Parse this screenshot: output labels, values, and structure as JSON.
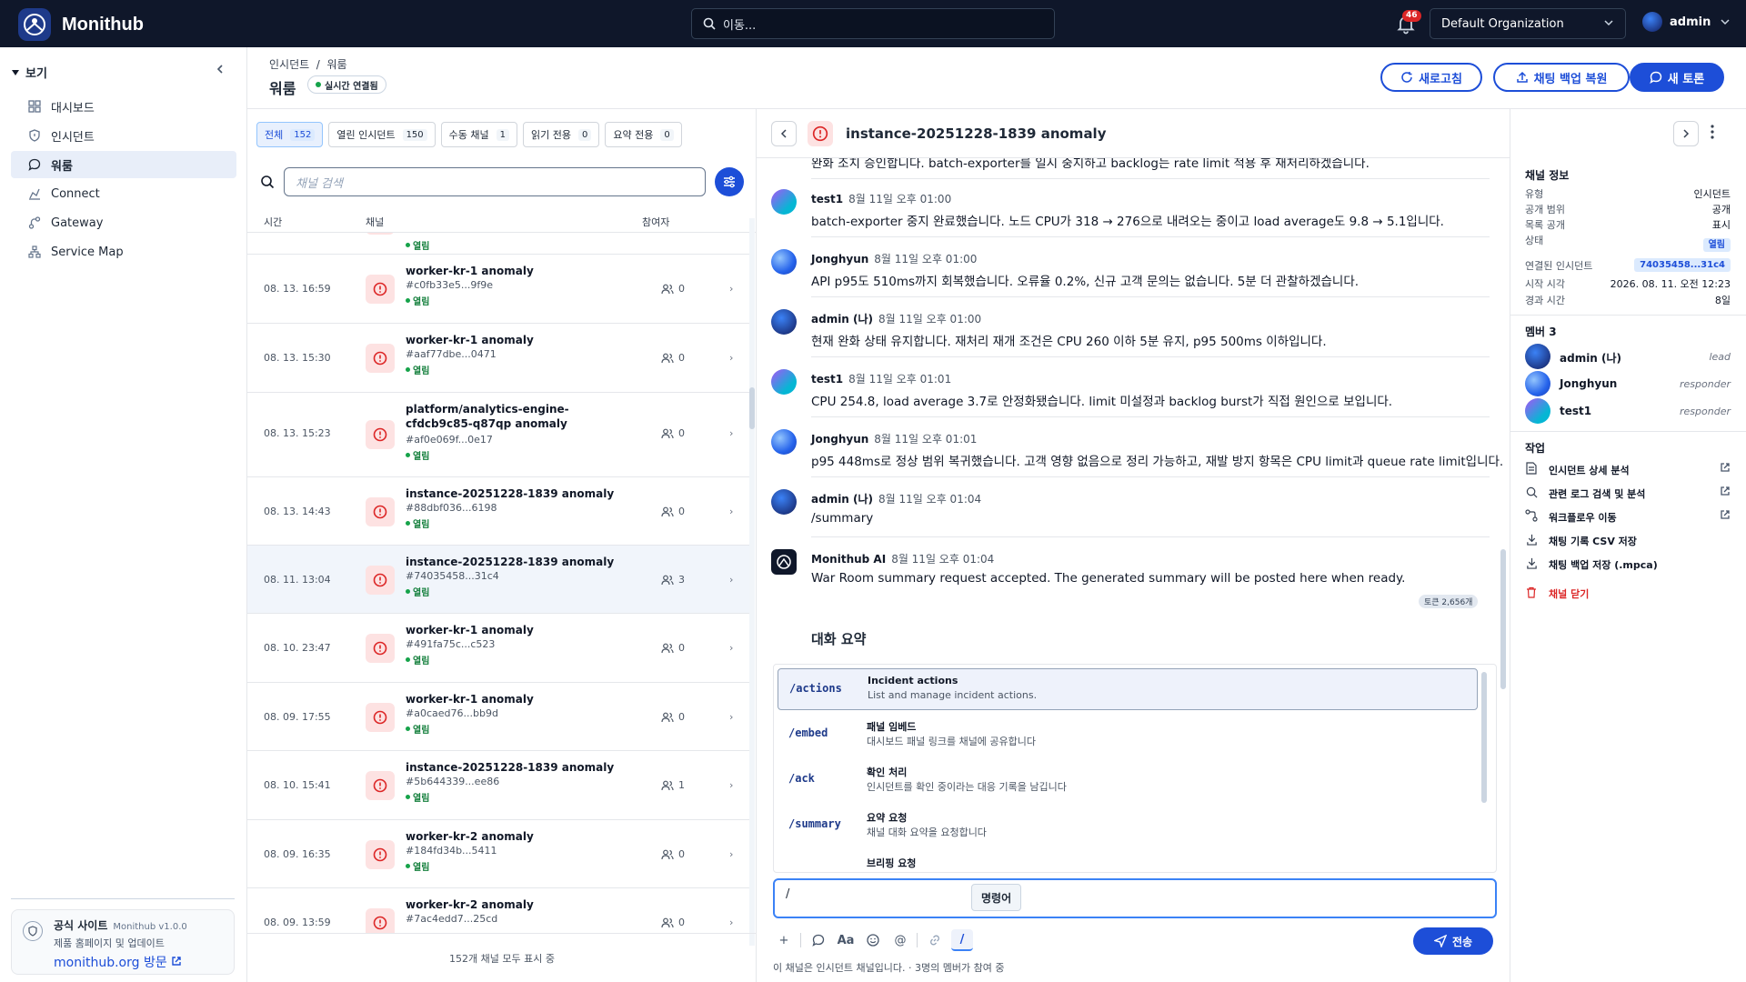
{
  "app": {
    "name": "Monithub",
    "search_placeholder": "이동...",
    "notif_count": "46",
    "org": "Default Organization",
    "user": "admin"
  },
  "sidebar": {
    "header": "보기",
    "items": [
      {
        "label": "대시보드",
        "icon": "dashboard-icon"
      },
      {
        "label": "인시던트",
        "icon": "shield-icon"
      },
      {
        "label": "워룸",
        "icon": "chat-icon"
      },
      {
        "label": "Connect",
        "icon": "connect-icon"
      },
      {
        "label": "Gateway",
        "icon": "gateway-icon"
      },
      {
        "label": "Service Map",
        "icon": "service-map-icon"
      }
    ],
    "promo": {
      "title": "공식 사이트",
      "version": "Monithub v1.0.0",
      "subtitle": "제품 홈페이지 및 업데이트",
      "link": "monithub.org 방문"
    }
  },
  "header": {
    "breadcrumb": "인시던트  /  워룸",
    "title": "워룸",
    "live": "실시간 연결됨",
    "buttons": {
      "refresh": "새로고침",
      "restore": "채팅 백업 복원",
      "new": "새 토론"
    }
  },
  "list": {
    "tabs": [
      {
        "label": "전체",
        "count": "152"
      },
      {
        "label": "열린 인시던트",
        "count": "150"
      },
      {
        "label": "수동 채널",
        "count": "1"
      },
      {
        "label": "읽기 전용",
        "count": "0"
      },
      {
        "label": "요약 전용",
        "count": "0"
      }
    ],
    "search_placeholder": "채널 검색",
    "columns": {
      "time": "시간",
      "channel": "채널",
      "participants": "참여자"
    },
    "rows": [
      {
        "time": "",
        "name": "",
        "id": "",
        "status": "열림",
        "participants": ""
      },
      {
        "time": "08. 13. 16:59",
        "name": "worker-kr-1 anomaly",
        "id": "#c0fb33e5...9f9e",
        "status": "열림",
        "participants": "0"
      },
      {
        "time": "08. 13. 15:30",
        "name": "worker-kr-1 anomaly",
        "id": "#aaf77dbe...0471",
        "status": "열림",
        "participants": "0"
      },
      {
        "time": "08. 13. 15:23",
        "name": "platform/analytics-engine-cfdcb9c85-q87qp anomaly",
        "id": "#af0e069f...0e17",
        "status": "열림",
        "participants": "0"
      },
      {
        "time": "08. 13. 14:43",
        "name": "instance-20251228-1839 anomaly",
        "id": "#88dbf036...6198",
        "status": "열림",
        "participants": "0"
      },
      {
        "time": "08. 11. 13:04",
        "name": "instance-20251228-1839 anomaly",
        "id": "#74035458...31c4",
        "status": "열림",
        "participants": "3"
      },
      {
        "time": "08. 10. 23:47",
        "name": "worker-kr-1 anomaly",
        "id": "#491fa75c...c523",
        "status": "열림",
        "participants": "0"
      },
      {
        "time": "08. 09. 17:55",
        "name": "worker-kr-1 anomaly",
        "id": "#a0caed76...bb9d",
        "status": "열림",
        "participants": "0"
      },
      {
        "time": "08. 10. 15:41",
        "name": "instance-20251228-1839 anomaly",
        "id": "#5b644339...ee86",
        "status": "열림",
        "participants": "1"
      },
      {
        "time": "08. 09. 16:35",
        "name": "worker-kr-2 anomaly",
        "id": "#184fd34b...5411",
        "status": "열림",
        "participants": "0"
      },
      {
        "time": "08. 09. 13:59",
        "name": "worker-kr-2 anomaly",
        "id": "#7ac4edd7...25cd",
        "status": "",
        "participants": "0"
      }
    ],
    "footer": "152개 채널 모두 표시 중"
  },
  "chat": {
    "title": "instance-20251228-1839 anomaly",
    "messages": [
      {
        "author": "",
        "time": "",
        "text": "완화 조치 승인합니다. batch-exporter를 일시 중지하고 backlog는 rate limit 적용 후 재처리하겠습니다."
      },
      {
        "author": "test1",
        "time": "8월 11일 오후 01:00",
        "text": "batch-exporter 중지 완료했습니다. 노드 CPU가 318 → 276으로 내려오는 중이고 load average도 9.8 → 5.1입니다."
      },
      {
        "author": "Jonghyun",
        "time": "8월 11일 오후 01:00",
        "text": "API p95도 510ms까지 회복했습니다. 오류율 0.2%, 신규 고객 문의는 없습니다. 5분 더 관찰하겠습니다."
      },
      {
        "author": "admin (나)",
        "time": "8월 11일 오후 01:00",
        "text": "현재 완화 상태 유지합니다. 재처리 재개 조건은 CPU 260 이하 5분 유지, p95 500ms 이하입니다."
      },
      {
        "author": "test1",
        "time": "8월 11일 오후 01:01",
        "text": "CPU 254.8, load average 3.7로 안정화됐습니다. limit 미설정과 backlog burst가 직접 원인으로 보입니다."
      },
      {
        "author": "Jonghyun",
        "time": "8월 11일 오후 01:01",
        "text": "p95 448ms로 정상 범위 복귀했습니다. 고객 영향 없음으로 정리 가능하고, 재발 방지 항목은 CPU limit과 queue rate limit입니다."
      },
      {
        "author": "admin (나)",
        "time": "8월 11일 오후 01:04",
        "text": "/summary"
      },
      {
        "author": "Monithub AI",
        "time": "8월 11일 오후 01:04",
        "text": "War Room summary request accepted. The generated summary will be posted here when ready."
      }
    ],
    "token_badge": "토큰 2,656개",
    "summary_heading": "대화 요약",
    "commands": [
      {
        "cmd": "/actions",
        "title": "Incident actions",
        "desc": "List and manage incident actions."
      },
      {
        "cmd": "/embed",
        "title": "패널 임베드",
        "desc": "대시보드 패널 링크를 채널에 공유합니다"
      },
      {
        "cmd": "/ack",
        "title": "확인 처리",
        "desc": "인시던트를 확인 중이라는 대응 기록을 남깁니다"
      },
      {
        "cmd": "/summary",
        "title": "요약 요청",
        "desc": "채널 대화 요약을 요청합니다"
      },
      {
        "cmd": "",
        "title": "브리핑 요청",
        "desc": ""
      }
    ],
    "input_value": "/",
    "tooltip": "명령어",
    "send": "전송",
    "footer": "이 채널은 인시던트 채널입니다. · 3명의 멤버가 참여 중"
  },
  "info": {
    "title": "채널 정보",
    "rows": [
      {
        "k": "유형",
        "v": "인시던트"
      },
      {
        "k": "공개 범위",
        "v": "공개"
      },
      {
        "k": "목록 공개",
        "v": "표시"
      },
      {
        "k": "상태",
        "v": "열림"
      },
      {
        "k": "연결된 인시던트",
        "v": "74035458...31c4"
      },
      {
        "k": "시작 시각",
        "v": "2026. 08. 11. 오전 12:23"
      },
      {
        "k": "경과 시간",
        "v": "8일"
      }
    ],
    "members_title": "멤버 3",
    "members": [
      {
        "name": "admin (나)",
        "role": "lead"
      },
      {
        "name": "Jonghyun",
        "role": "responder"
      },
      {
        "name": "test1",
        "role": "responder"
      }
    ],
    "actions_title": "작업",
    "actions": [
      {
        "label": "인시던트 상세 분석"
      },
      {
        "label": "관련 로그 검색 및 분석"
      },
      {
        "label": "워크플로우 이동"
      },
      {
        "label": "채팅 기록 CSV 저장"
      },
      {
        "label": "채팅 백업 저장 (.mpca)"
      },
      {
        "label": "채널 닫기"
      }
    ]
  }
}
